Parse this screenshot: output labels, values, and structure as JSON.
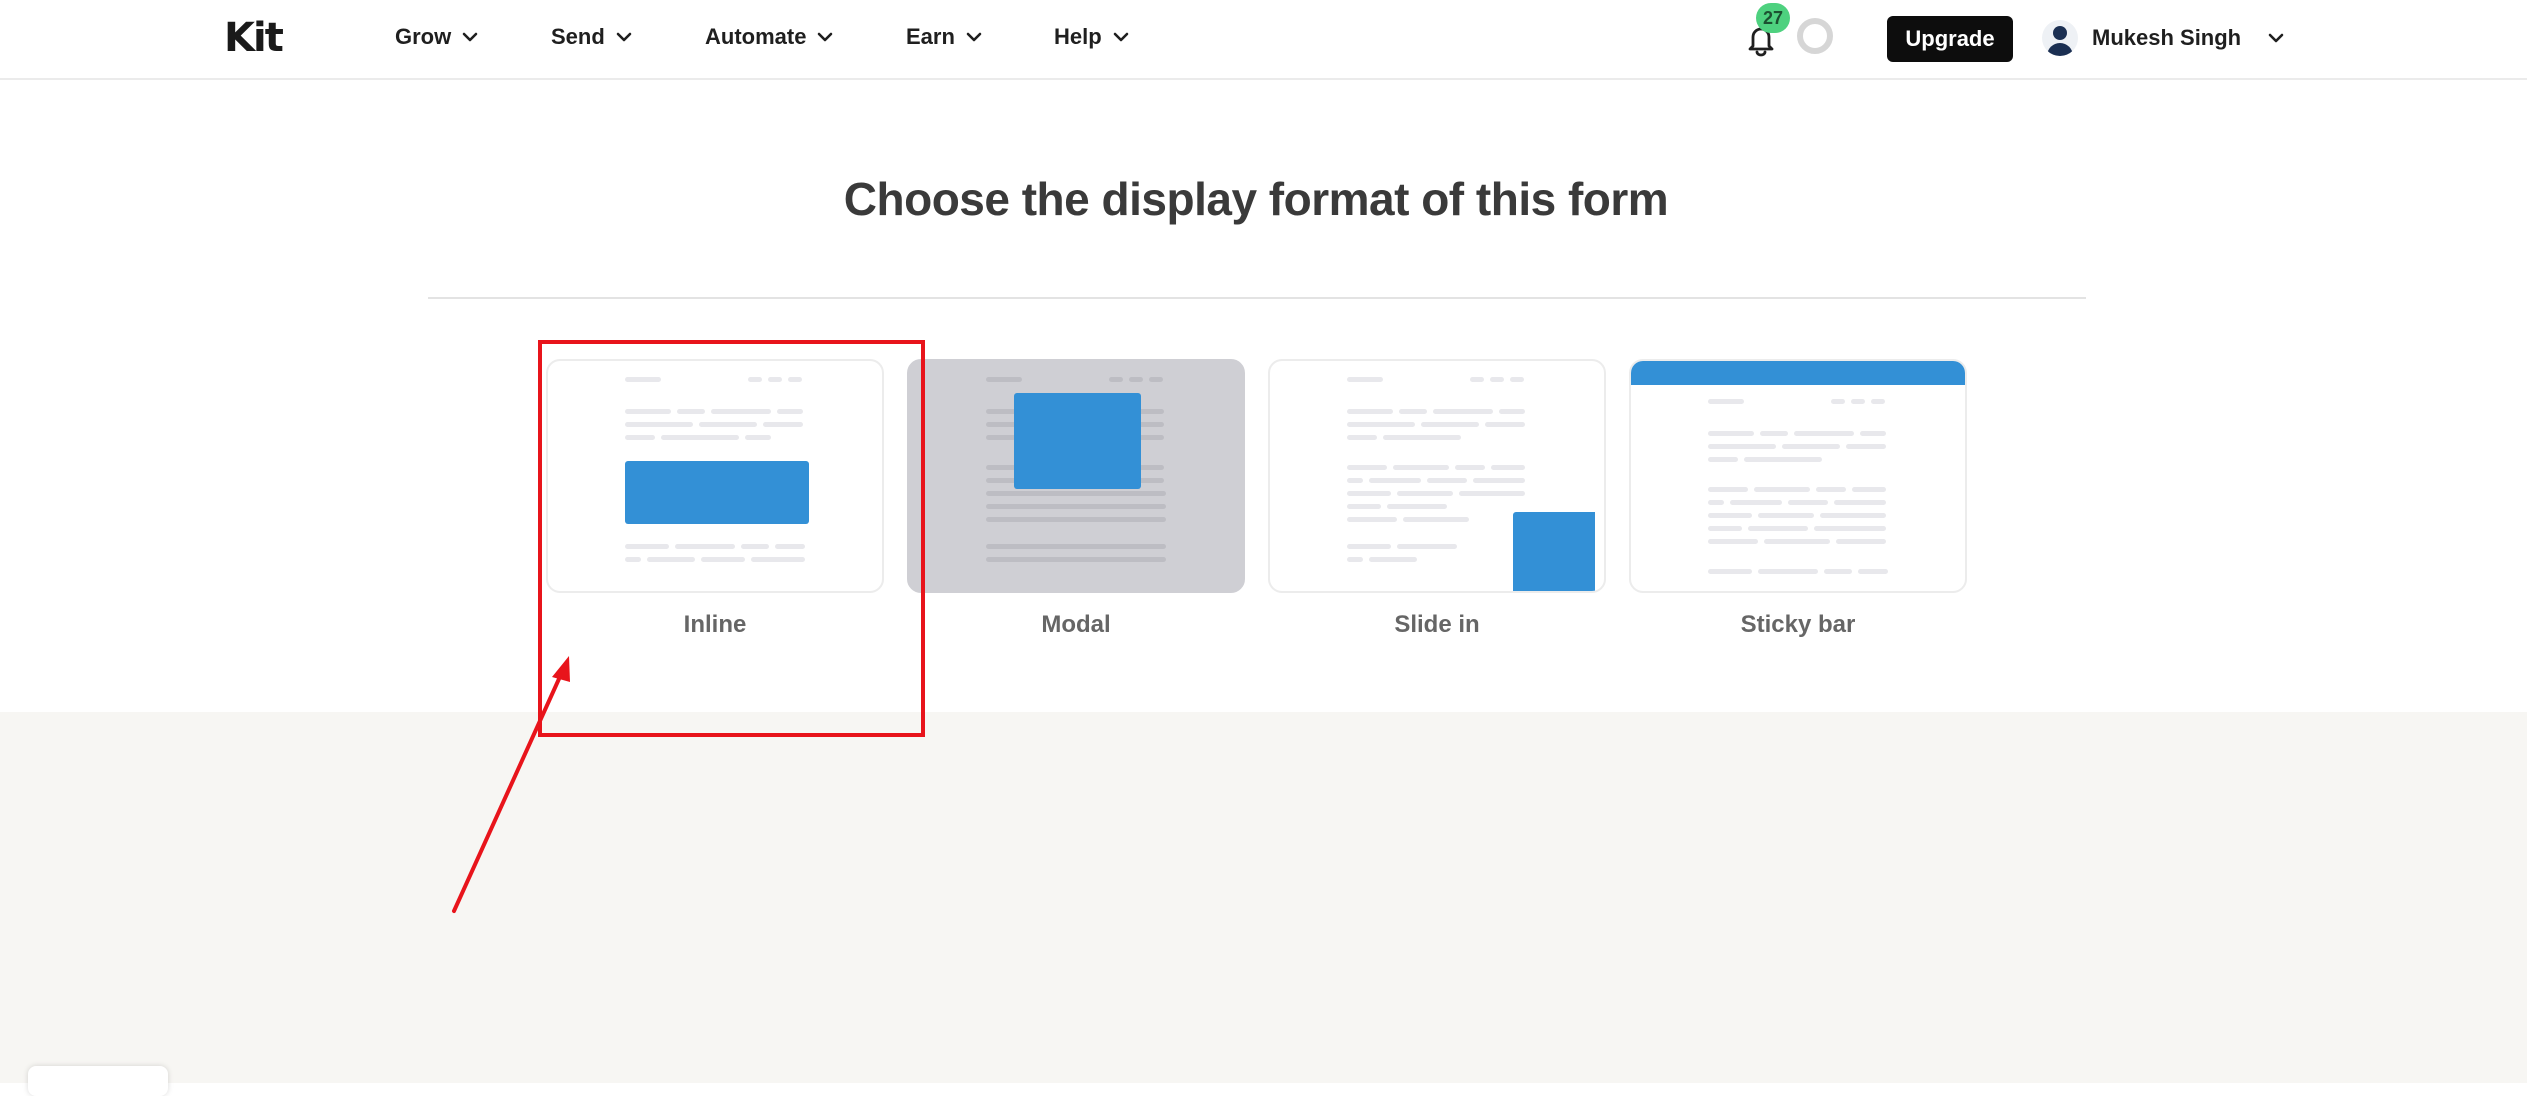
{
  "header": {
    "logo": "Kit",
    "nav": [
      {
        "label": "Grow"
      },
      {
        "label": "Send"
      },
      {
        "label": "Automate"
      },
      {
        "label": "Earn"
      },
      {
        "label": "Help"
      }
    ],
    "notifications_count": "27",
    "upgrade_label": "Upgrade",
    "user_name": "Mukesh Singh"
  },
  "main": {
    "heading": "Choose the display format of this form",
    "formats": [
      {
        "label": "Inline",
        "icon": "inline-preview-icon"
      },
      {
        "label": "Modal",
        "icon": "modal-preview-icon"
      },
      {
        "label": "Slide in",
        "icon": "slide-in-preview-icon"
      },
      {
        "label": "Sticky bar",
        "icon": "sticky-bar-preview-icon"
      }
    ]
  },
  "colors": {
    "accent_blue": "#3390d6",
    "badge_green": "#4ed17f",
    "annotation_red": "#e8141b",
    "modal_overlay": "#cfcfd4",
    "footer_bg": "#f7f6f3"
  }
}
